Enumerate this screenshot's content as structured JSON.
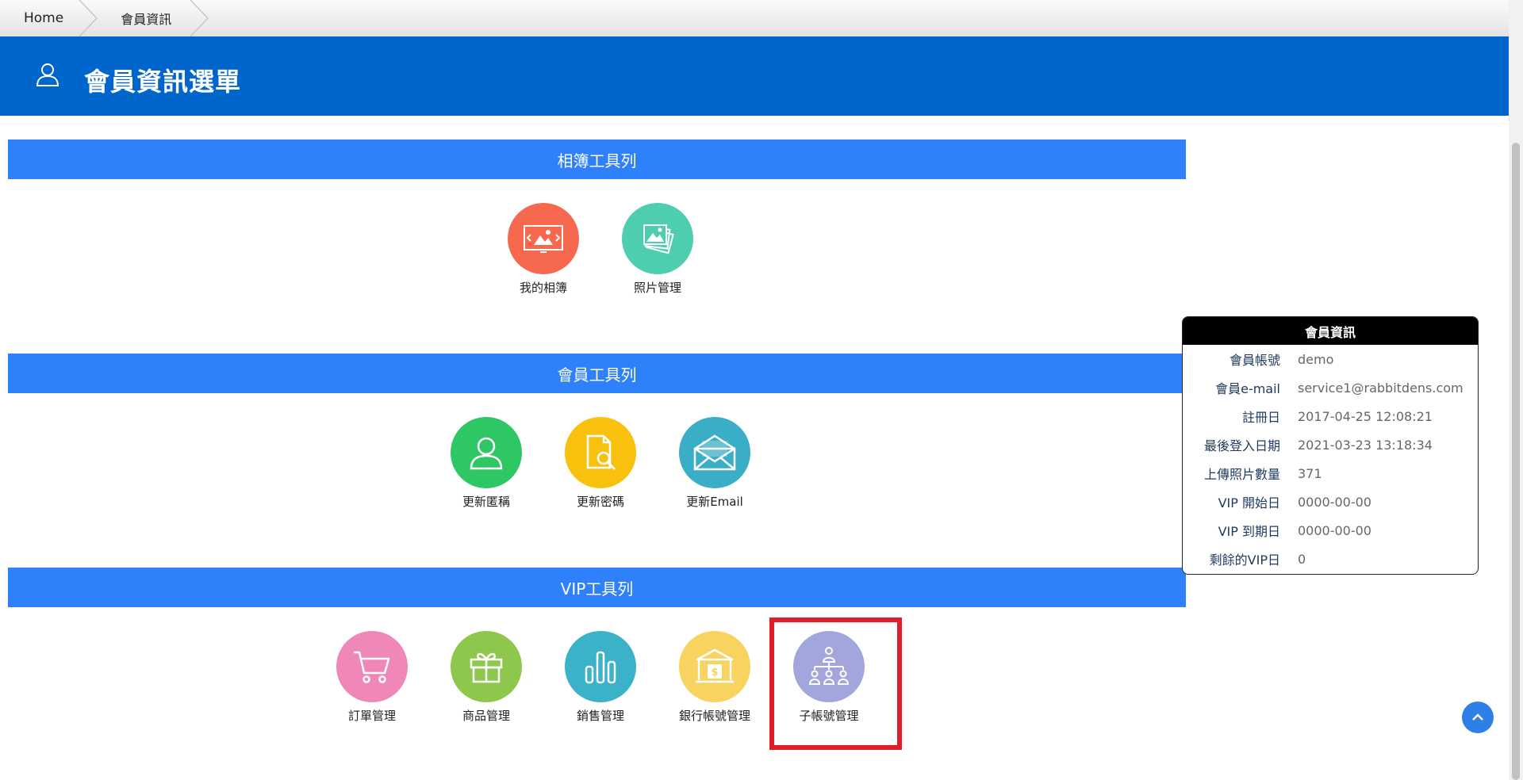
{
  "breadcrumb": {
    "home": "Home",
    "current": "會員資訊"
  },
  "header": {
    "title": "會員資訊選單",
    "icon": "user-icon"
  },
  "sections": {
    "album": {
      "title": "相簿工具列",
      "items": [
        {
          "label": "我的相簿",
          "icon": "album-icon",
          "color": "#f7694f"
        },
        {
          "label": "照片管理",
          "icon": "photos-icon",
          "color": "#4ecdb0"
        }
      ]
    },
    "member": {
      "title": "會員工具列",
      "items": [
        {
          "label": "更新匿稱",
          "icon": "user-icon",
          "color": "#2ec764"
        },
        {
          "label": "更新密碼",
          "icon": "document-search-icon",
          "color": "#f8c10d"
        },
        {
          "label": "更新Email",
          "icon": "envelope-icon",
          "color": "#3aaec6"
        }
      ]
    },
    "vip": {
      "title": "VIP工具列",
      "items": [
        {
          "label": "訂單管理",
          "icon": "cart-icon",
          "color": "#ef88b9"
        },
        {
          "label": "商品管理",
          "icon": "gift-icon",
          "color": "#8dc84d"
        },
        {
          "label": "銷售管理",
          "icon": "bar-chart-icon",
          "color": "#3bb2c8"
        },
        {
          "label": "銀行帳號管理",
          "icon": "bank-icon",
          "color": "#f8d35f"
        },
        {
          "label": "子帳號管理",
          "icon": "org-chart-icon",
          "color": "#a3a6dc"
        }
      ]
    }
  },
  "member_info": {
    "title": "會員資訊",
    "rows": [
      {
        "key": "會員帳號",
        "value": "demo"
      },
      {
        "key": "會員e-mail",
        "value": "service1@rabbitdens.com"
      },
      {
        "key": "註冊日",
        "value": "2017-04-25 12:08:21"
      },
      {
        "key": "最後登入日期",
        "value": "2021-03-23 13:18:34"
      },
      {
        "key": "上傳照片數量",
        "value": "371"
      },
      {
        "key": "VIP 開始日",
        "value": "0000-00-00"
      },
      {
        "key": "VIP 到期日",
        "value": "0000-00-00"
      },
      {
        "key": "剩餘的VIP日",
        "value": "0"
      }
    ]
  },
  "colors": {
    "header": "#0066cc",
    "section_bar": "#2e80fb",
    "highlight": "#e11d2a"
  }
}
